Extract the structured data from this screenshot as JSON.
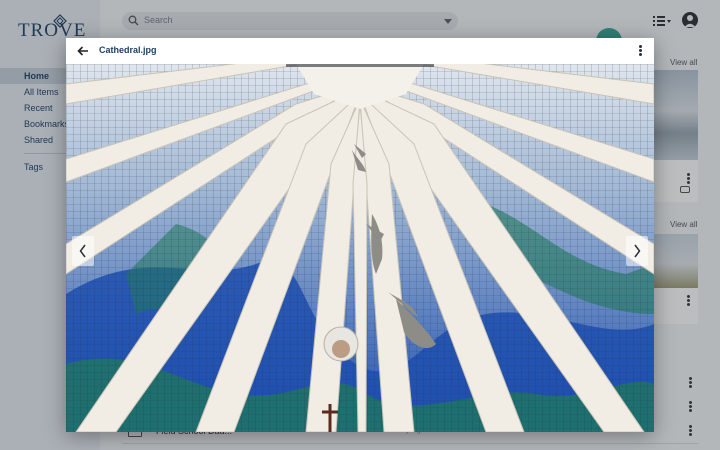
{
  "app": {
    "logo_text": "TROVE"
  },
  "sidebar": {
    "items": [
      {
        "label": "Home"
      },
      {
        "label": "All Items"
      },
      {
        "label": "Recent"
      },
      {
        "label": "Bookmarks"
      },
      {
        "label": "Shared"
      },
      {
        "label": "Tags"
      }
    ]
  },
  "topbar": {
    "search_placeholder": "Search"
  },
  "main": {
    "view_all_label": "View all",
    "row_name": "Field School Dau...",
    "row_meta": "Modified 2 days ago"
  },
  "viewer": {
    "title": "Cathedral.jpg",
    "back_icon": "arrow-left-icon",
    "more_icon": "more-vert-icon"
  },
  "colors": {
    "brand": "#23446b",
    "accent": "#3aa596",
    "sky_blue": "#1d4fb0",
    "glass_green": "#1f7a5a"
  }
}
